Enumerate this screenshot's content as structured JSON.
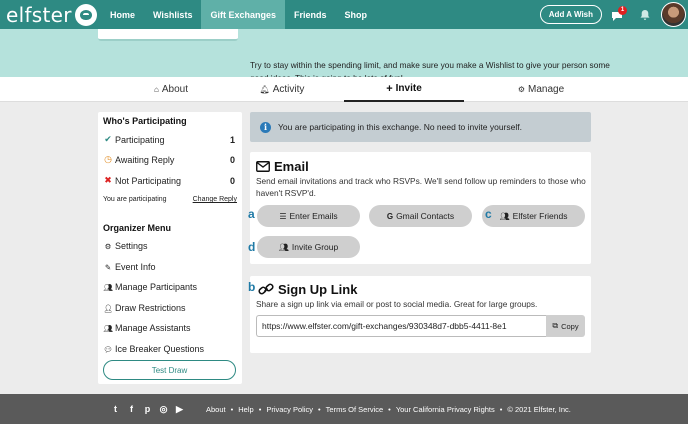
{
  "nav": {
    "logo": "elfster",
    "items": [
      "Home",
      "Wishlists",
      "Gift Exchanges",
      "Friends",
      "Shop"
    ],
    "active_index": 2,
    "add_wish": "Add A Wish",
    "chat_badge": "1"
  },
  "hero": {
    "text": "Try to stay within the spending limit, and make sure you make a Wishlist to give your person some good ideas. This is going to be lots of fun!"
  },
  "tabs": [
    {
      "label": "About",
      "icon": "home-icon"
    },
    {
      "label": "Activity",
      "icon": "bell-icon"
    },
    {
      "label": "Invite",
      "icon": "plus-icon"
    },
    {
      "label": "Manage",
      "icon": "gear-icon"
    }
  ],
  "participating": {
    "title": "Who's Participating",
    "rows": [
      {
        "label": "Participating",
        "count": "1",
        "icon": "check-icon",
        "color": "#2e8a83"
      },
      {
        "label": "Awaiting Reply",
        "count": "0",
        "icon": "clock-icon",
        "color": "#e08a1e"
      },
      {
        "label": "Not Participating",
        "count": "0",
        "icon": "x-icon",
        "color": "#d22"
      }
    ],
    "status": "You are participating",
    "change_reply": "Change Reply"
  },
  "organizer": {
    "title": "Organizer Menu",
    "items": [
      {
        "label": "Settings",
        "icon": "gear-icon"
      },
      {
        "label": "Event Info",
        "icon": "pencil-icon"
      },
      {
        "label": "Manage Participants",
        "icon": "users-icon"
      },
      {
        "label": "Draw Restrictions",
        "icon": "user-block-icon"
      },
      {
        "label": "Manage Assistants",
        "icon": "users-icon"
      },
      {
        "label": "Ice Breaker Questions",
        "icon": "comment-icon"
      }
    ],
    "test_draw": "Test Draw"
  },
  "notice": "You are participating in this exchange. No need to invite yourself.",
  "email": {
    "title": "Email",
    "desc": "Send email invitations and track who RSVPs. We'll send follow up reminders to those who haven't RSVP'd.",
    "buttons": [
      "Enter Emails",
      "Gmail Contacts",
      "Elfster Friends",
      "Invite Group"
    ],
    "markers": [
      "a",
      "c",
      "d"
    ]
  },
  "signup": {
    "title": "Sign Up Link",
    "desc": "Share a sign up link via email or post to social media. Great for large groups.",
    "url": "https://www.elfster.com/gift-exchanges/930348d7-dbb5-4411-8e1",
    "copy": "Copy",
    "marker": "b"
  },
  "footer": {
    "links": [
      "About",
      "Help",
      "Privacy Policy",
      "Terms Of Service",
      "Your California Privacy Rights",
      "© 2021 Elfster, Inc."
    ]
  }
}
